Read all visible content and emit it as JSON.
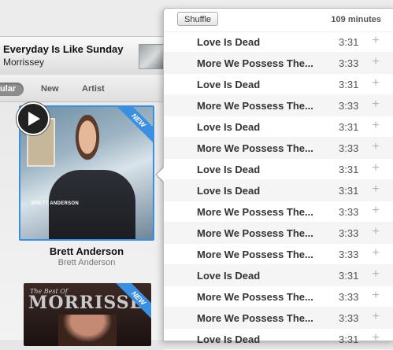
{
  "now_playing": {
    "title": "Everyday Is Like Sunday",
    "artist": "Morrissey"
  },
  "filters": {
    "items": [
      {
        "label": "ular",
        "active": true
      },
      {
        "label": "New",
        "active": false
      },
      {
        "label": "Artist",
        "active": false
      }
    ]
  },
  "albums": [
    {
      "title": "Brett Anderson",
      "artist": "Brett Anderson",
      "badge": "NEW",
      "art_text": "BRETT ANDERSON"
    },
    {
      "badge": "NEW",
      "art_text_top": "The Best Of",
      "art_text_main": "MORRISSE"
    }
  ],
  "popover": {
    "shuffle_label": "Shuffle",
    "duration": "109 minutes",
    "add_icon": "+",
    "tracks": [
      {
        "name": "Love Is Dead",
        "time": "3:31"
      },
      {
        "name": "More We Possess The...",
        "time": "3:33"
      },
      {
        "name": "Love Is Dead",
        "time": "3:31"
      },
      {
        "name": "More We Possess The...",
        "time": "3:33"
      },
      {
        "name": "Love Is Dead",
        "time": "3:31"
      },
      {
        "name": "More We Possess The...",
        "time": "3:33"
      },
      {
        "name": "Love Is Dead",
        "time": "3:31"
      },
      {
        "name": "Love Is Dead",
        "time": "3:31"
      },
      {
        "name": "More We Possess The...",
        "time": "3:33"
      },
      {
        "name": "More We Possess The...",
        "time": "3:33"
      },
      {
        "name": "More We Possess The...",
        "time": "3:33"
      },
      {
        "name": "Love Is Dead",
        "time": "3:31"
      },
      {
        "name": "More We Possess The...",
        "time": "3:33"
      },
      {
        "name": "More We Possess The...",
        "time": "3:33"
      },
      {
        "name": "Love Is Dead",
        "time": "3:31"
      }
    ]
  },
  "colors": {
    "accent": "#3a8fe0",
    "alt_row": "#f5f5f5"
  }
}
